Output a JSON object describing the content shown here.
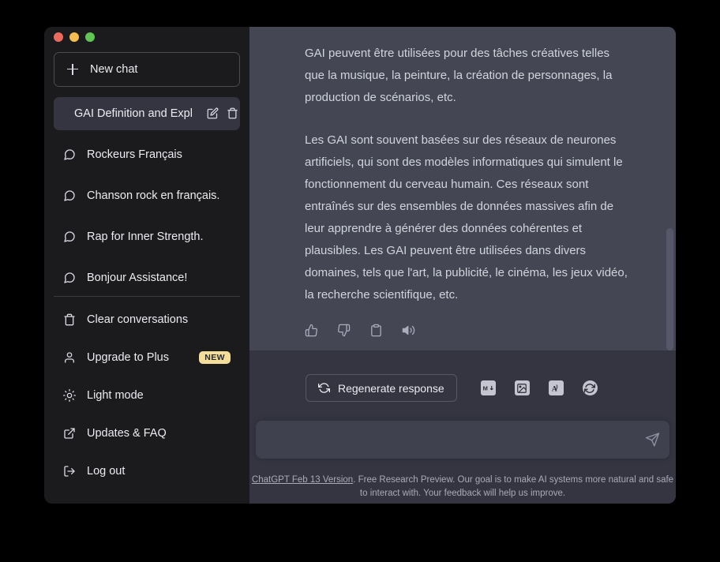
{
  "window": {
    "traffic_lights": [
      {
        "name": "close",
        "color": "#ed6a5e"
      },
      {
        "name": "minimize",
        "color": "#f5bd4f"
      },
      {
        "name": "maximize",
        "color": "#61c554"
      }
    ]
  },
  "sidebar": {
    "new_chat_label": "New chat",
    "chats": [
      {
        "label": "GAI Definition and Expl",
        "active": true
      },
      {
        "label": "Rockeurs Français",
        "active": false
      },
      {
        "label": "Chanson rock en français.",
        "active": false
      },
      {
        "label": "Rap for Inner Strength.",
        "active": false
      },
      {
        "label": "Bonjour Assistance!",
        "active": false
      }
    ],
    "menu": [
      {
        "label": "Clear conversations",
        "icon": "trash-icon",
        "badge": ""
      },
      {
        "label": "Upgrade to Plus",
        "icon": "user-icon",
        "badge": "NEW"
      },
      {
        "label": "Light mode",
        "icon": "sun-icon",
        "badge": ""
      },
      {
        "label": "Updates & FAQ",
        "icon": "external-link-icon",
        "badge": ""
      },
      {
        "label": "Log out",
        "icon": "logout-icon",
        "badge": ""
      }
    ],
    "badge_color": "#f5de9a"
  },
  "main": {
    "message": {
      "paragraph_1": "GAI peuvent être utilisées pour des tâches créatives telles que la musique, la peinture, la création de personnages, la production de scénarios, etc.",
      "paragraph_2": "Les GAI sont souvent basées sur des réseaux de neurones artificiels, qui sont des modèles informatiques qui simulent le fonctionnement du cerveau humain. Ces réseaux sont entraînés sur des ensembles de données massives afin de leur apprendre à générer des données cohérentes et plausibles. Les GAI peuvent être utilisées dans divers domaines, tels que l'art, la publicité, le cinéma, les jeux vidéo, la recherche scientifique, etc."
    },
    "message_actions": [
      {
        "name": "thumbs-up-icon"
      },
      {
        "name": "thumbs-down-icon"
      },
      {
        "name": "clipboard-icon"
      },
      {
        "name": "speaker-icon"
      }
    ],
    "regenerate_label": "Regenerate response",
    "export_buttons": [
      {
        "name": "export-markdown-icon",
        "glyph": "M↓"
      },
      {
        "name": "export-image-icon",
        "glyph": "image"
      },
      {
        "name": "export-pdf-icon",
        "glyph": "pdf"
      },
      {
        "name": "refresh-sync-icon",
        "glyph": "sync"
      }
    ],
    "input": {
      "value": "",
      "placeholder": ""
    },
    "footer": {
      "link_text": "ChatGPT Feb 13 Version",
      "rest_text": ". Free Research Preview. Our goal is to make AI systems more natural and safe to interact with. Your feedback will help us improve."
    }
  }
}
